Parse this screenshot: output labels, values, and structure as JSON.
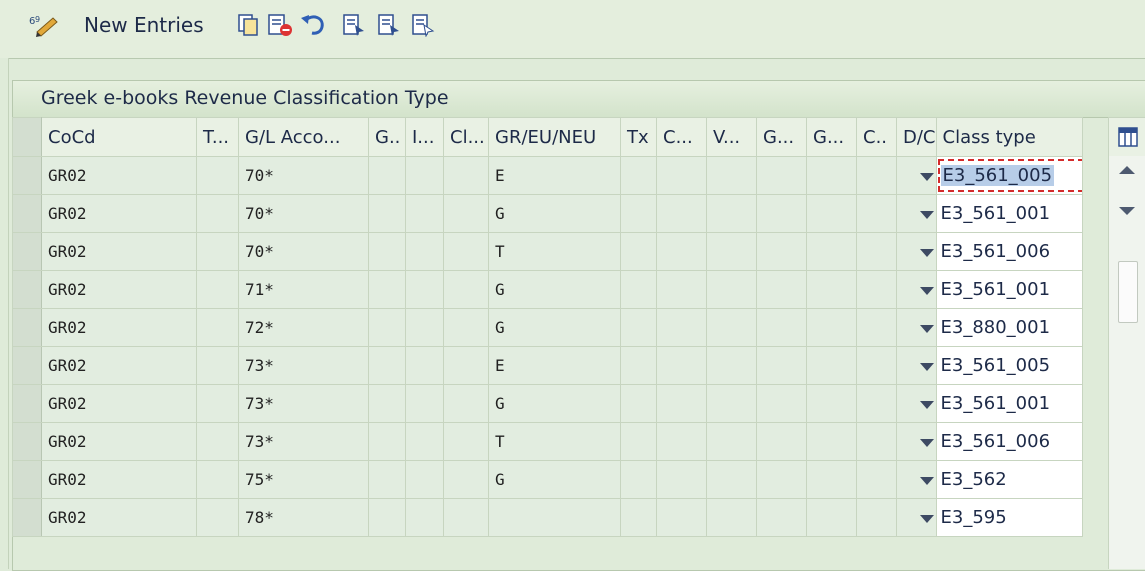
{
  "toolbar": {
    "new_entries_label": "New Entries",
    "icons": [
      "display-change-icon",
      "copy-icon",
      "delete-icon",
      "undo-icon",
      "select-all-icon",
      "select-block-icon",
      "deselect-all-icon"
    ]
  },
  "panel": {
    "title": "Greek e-books Revenue Classification Type"
  },
  "table": {
    "columns": [
      "CoCd",
      "T...",
      "G/L Acco...",
      "G..",
      "I...",
      "Cl...",
      "GR/EU/NEU",
      "Tx",
      "C...",
      "V...",
      "G...",
      "G...",
      "C..",
      "D/C",
      "Class type"
    ],
    "rows": [
      {
        "cocd": "GR02",
        "gl": "70*",
        "region": "E",
        "class_type": "E3_561_005"
      },
      {
        "cocd": "GR02",
        "gl": "70*",
        "region": "G",
        "class_type": "E3_561_001"
      },
      {
        "cocd": "GR02",
        "gl": "70*",
        "region": "T",
        "class_type": "E3_561_006"
      },
      {
        "cocd": "GR02",
        "gl": "71*",
        "region": "G",
        "class_type": "E3_561_001"
      },
      {
        "cocd": "GR02",
        "gl": "72*",
        "region": "G",
        "class_type": "E3_880_001"
      },
      {
        "cocd": "GR02",
        "gl": "73*",
        "region": "E",
        "class_type": "E3_561_005"
      },
      {
        "cocd": "GR02",
        "gl": "73*",
        "region": "G",
        "class_type": "E3_561_001"
      },
      {
        "cocd": "GR02",
        "gl": "73*",
        "region": "T",
        "class_type": "E3_561_006"
      },
      {
        "cocd": "GR02",
        "gl": "75*",
        "region": "G",
        "class_type": "E3_562"
      },
      {
        "cocd": "GR02",
        "gl": "78*",
        "region": "",
        "class_type": "E3_595"
      }
    ]
  },
  "colors": {
    "background": "#dfebd9",
    "header": "#e9f1e4",
    "selected_cell_highlight": "#b7cde8",
    "focus_border": "#d42b2b"
  }
}
